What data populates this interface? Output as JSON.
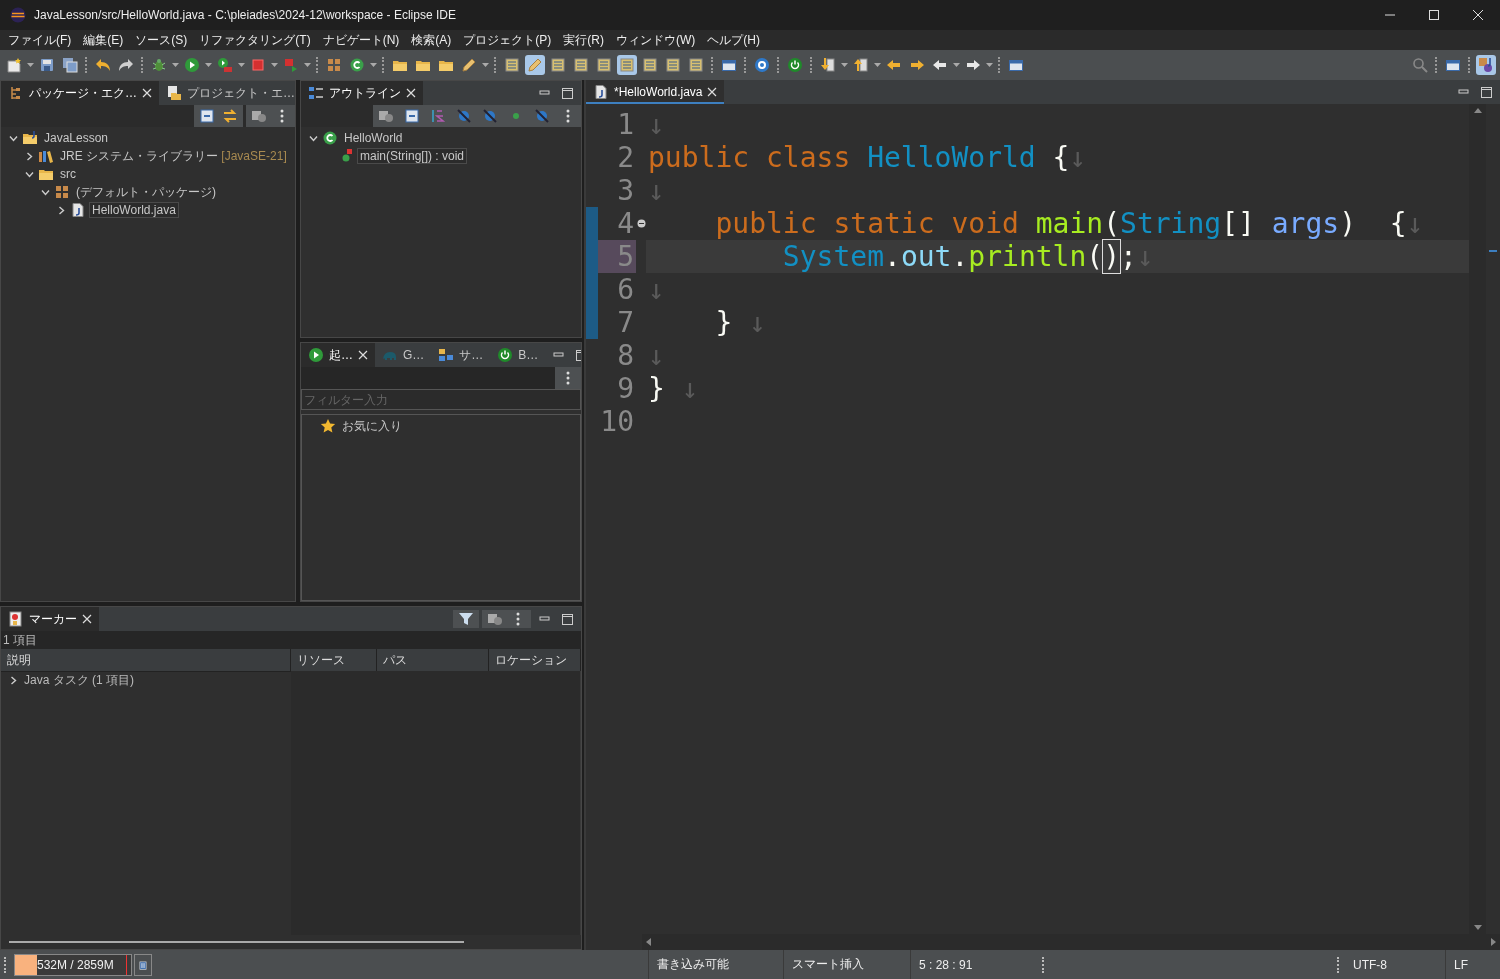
{
  "window": {
    "title": "JavaLesson/src/HelloWorld.java - C:\\pleiades\\2024-12\\workspace - Eclipse IDE"
  },
  "menu": [
    "ファイル(F)",
    "編集(E)",
    "ソース(S)",
    "リファクタリング(T)",
    "ナビゲート(N)",
    "検索(A)",
    "プロジェクト(P)",
    "実行(R)",
    "ウィンドウ(W)",
    "ヘルプ(H)"
  ],
  "toolbar": [
    {
      "on": false
    },
    {
      "on": false
    },
    {
      "on": false
    },
    {
      "on": false
    },
    {
      "on": false
    },
    {
      "on": false
    },
    {
      "on": false
    },
    {
      "on": false
    },
    {
      "on": false
    },
    {
      "on": false
    },
    {
      "on": false
    },
    {
      "on": false
    },
    {
      "on": false
    },
    {
      "on": false
    },
    {
      "on": false
    },
    {
      "on": false
    },
    {
      "on": false
    },
    {
      "on": true
    },
    {
      "on": false
    },
    {
      "on": false
    },
    {
      "on": false
    },
    {
      "on": true
    },
    {
      "on": false
    },
    {
      "on": false
    },
    {
      "on": false
    },
    {
      "on": false
    },
    {
      "on": false
    },
    {
      "on": false
    },
    {
      "on": false
    },
    {
      "on": false
    },
    {
      "on": false
    },
    {
      "on": false
    },
    {
      "on": false
    },
    {
      "on": false
    },
    {
      "on": false
    },
    {
      "on": false
    },
    {
      "on": false
    },
    {
      "on": true
    }
  ],
  "package_explorer": {
    "tabs": [
      {
        "label": "パッケージ・エク…",
        "selected": true
      },
      {
        "label": "プロジェクト・エ…",
        "selected": false
      }
    ],
    "tree": [
      {
        "kind": "project",
        "label": "JavaLesson",
        "expanded": true,
        "selected": false,
        "children": [
          {
            "kind": "library",
            "label": "JRE システム・ライブラリー",
            "decoration": "[JavaSE-21]",
            "expanded": false,
            "selected": false
          },
          {
            "kind": "folder",
            "label": "src",
            "expanded": true,
            "selected": false,
            "children": [
              {
                "kind": "package",
                "label": "(デフォルト・パッケージ)",
                "expanded": true,
                "selected": false,
                "children": [
                  {
                    "kind": "file",
                    "label": "HelloWorld.java",
                    "expanded": false,
                    "selected": true
                  }
                ]
              }
            ]
          }
        ]
      }
    ]
  },
  "outline": {
    "tabs": [
      {
        "label": "アウトライン",
        "selected": true
      }
    ],
    "tree": [
      {
        "kind": "class",
        "label": "HelloWorld",
        "expanded": true,
        "selected": false,
        "children": [
          {
            "kind": "method",
            "label": "main(String[]) : void",
            "selected": true
          }
        ]
      }
    ]
  },
  "launch": {
    "tabs": [
      {
        "label": "起…",
        "selected": true
      },
      {
        "label": "G…",
        "selected": false
      },
      {
        "label": "サ…",
        "selected": false
      },
      {
        "label": "B…",
        "selected": false
      }
    ],
    "filter": {
      "placeholder": "フィルター入力"
    },
    "items": [
      {
        "label": "お気に入り"
      }
    ]
  },
  "markers": {
    "tabs": [
      {
        "label": "マーカー",
        "selected": true
      }
    ],
    "summary": "1 項目",
    "columns": [
      "説明",
      "リソース",
      "パス",
      "ロケーション"
    ],
    "rows": [
      {
        "label": "Java タスク (1 項目)",
        "expanded": false
      }
    ]
  },
  "editor": {
    "tabs": [
      {
        "label": "*HelloWorld.java",
        "selected": true
      }
    ],
    "lines": [
      {
        "number": "1",
        "current": false,
        "changed": false,
        "fold": false,
        "tokens": [
          {
            "kind": "ws",
            "t": "↓"
          }
        ]
      },
      {
        "number": "2",
        "current": false,
        "changed": false,
        "fold": false,
        "tokens": [
          {
            "kind": "kw",
            "t": "public class "
          },
          {
            "kind": "cls",
            "t": "HelloWorld"
          },
          {
            "kind": "p",
            "t": " {"
          },
          {
            "kind": "ws",
            "t": "↓"
          }
        ]
      },
      {
        "number": "3",
        "current": false,
        "changed": false,
        "fold": false,
        "tokens": [
          {
            "kind": "ws",
            "t": "↓"
          }
        ]
      },
      {
        "number": "4",
        "current": false,
        "changed": true,
        "fold": true,
        "tokens": [
          {
            "kind": "kw",
            "t": "    public static void "
          },
          {
            "kind": "fn",
            "t": "main"
          },
          {
            "kind": "p",
            "t": "("
          },
          {
            "kind": "cls",
            "t": "String"
          },
          {
            "kind": "p",
            "t": "[] "
          },
          {
            "kind": "param",
            "t": "args"
          },
          {
            "kind": "p",
            "t": ")  {"
          },
          {
            "kind": "ws",
            "t": "↓"
          }
        ]
      },
      {
        "number": "5",
        "current": true,
        "changed": true,
        "fold": false,
        "tokens": [
          {
            "kind": "cls",
            "t": "        System"
          },
          {
            "kind": "p",
            "t": "."
          },
          {
            "kind": "field",
            "t": "out"
          },
          {
            "kind": "p",
            "t": "."
          },
          {
            "kind": "fn",
            "t": "println"
          },
          {
            "kind": "p",
            "t": "("
          },
          {
            "kind": "match",
            "t": ")"
          },
          {
            "kind": "p",
            "t": ";"
          },
          {
            "kind": "ws",
            "t": "↓"
          }
        ]
      },
      {
        "number": "6",
        "current": false,
        "changed": true,
        "fold": false,
        "tokens": [
          {
            "kind": "ws",
            "t": "↓"
          }
        ]
      },
      {
        "number": "7",
        "current": false,
        "changed": true,
        "fold": false,
        "tokens": [
          {
            "kind": "p",
            "t": "    } "
          },
          {
            "kind": "ws",
            "t": "↓"
          }
        ]
      },
      {
        "number": "8",
        "current": false,
        "changed": false,
        "fold": false,
        "tokens": [
          {
            "kind": "ws",
            "t": "↓"
          }
        ]
      },
      {
        "number": "9",
        "current": false,
        "changed": false,
        "fold": false,
        "tokens": [
          {
            "kind": "p",
            "t": "} "
          },
          {
            "kind": "ws",
            "t": "↓"
          }
        ]
      },
      {
        "number": "10",
        "current": false,
        "changed": false,
        "fold": false
      }
    ]
  },
  "status": {
    "memory": {
      "text": "532M / 2859M",
      "level": 0.19
    },
    "writable": "書き込み可能",
    "insert_mode": "スマート挿入",
    "position": "5 : 28 : 91",
    "encoding": "UTF-8",
    "line_delimiter": "LF"
  }
}
